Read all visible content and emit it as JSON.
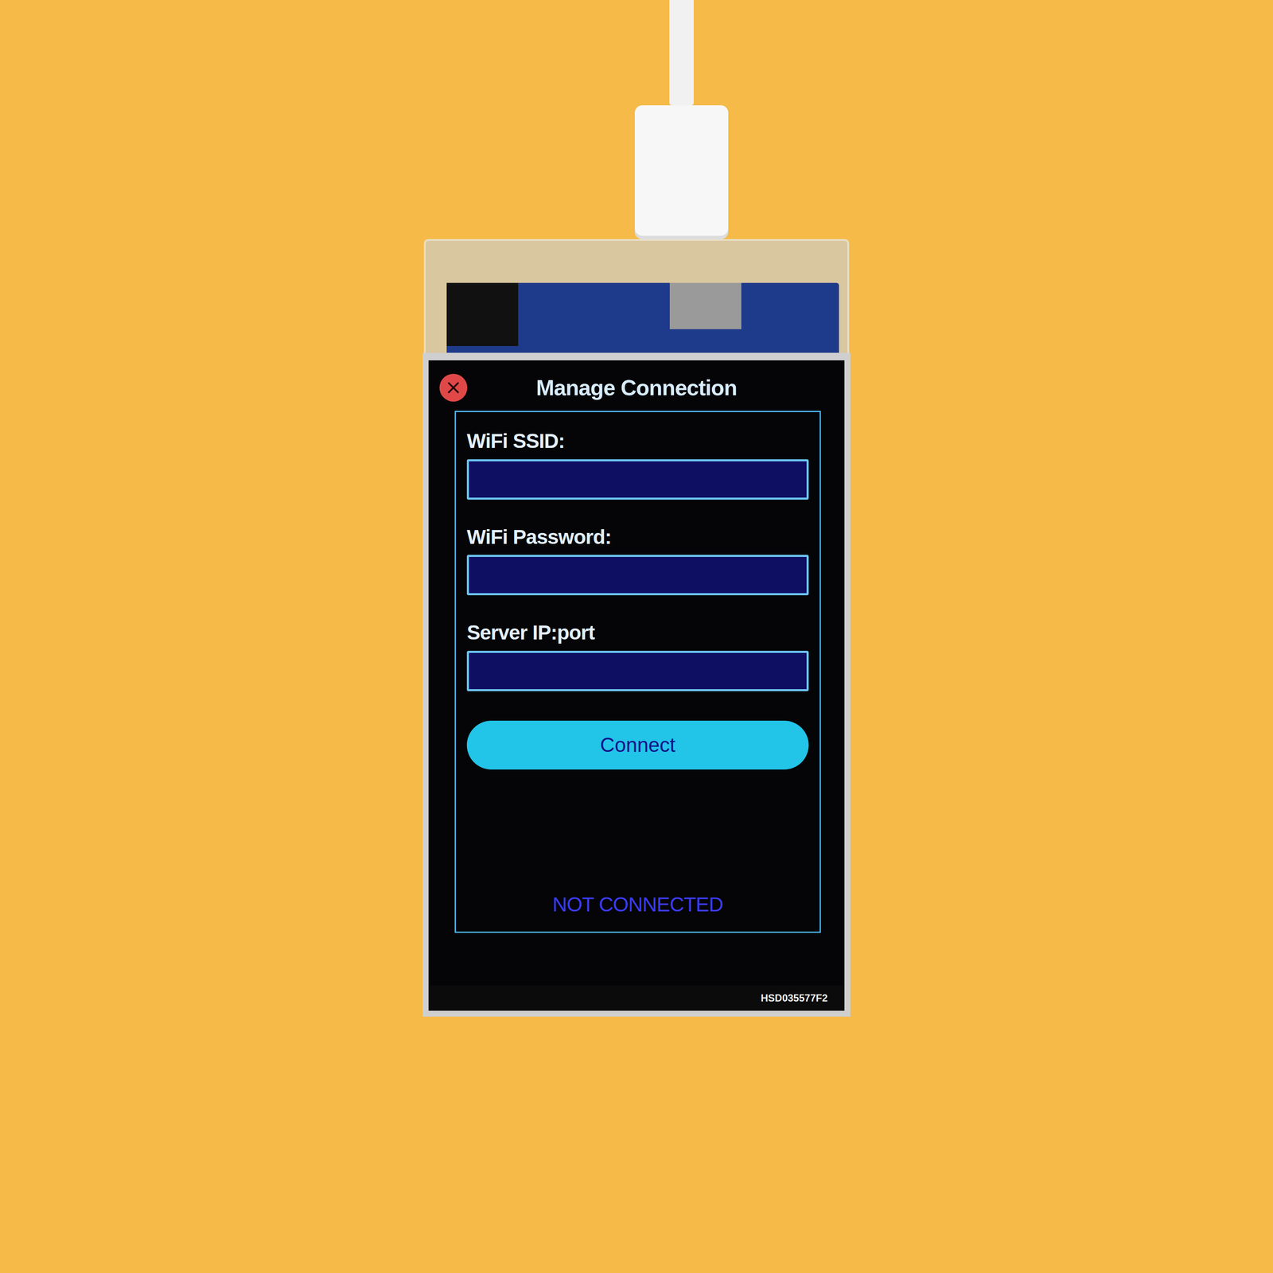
{
  "screen": {
    "title": "Manage Connection",
    "fields": [
      {
        "label": "WiFi SSID:",
        "value": ""
      },
      {
        "label": "WiFi Password:",
        "value": ""
      },
      {
        "label": "Server IP:port",
        "value": ""
      }
    ],
    "button": "Connect",
    "status": "NOT CONNECTED"
  },
  "hardware": {
    "label": "HSD035577F2"
  }
}
